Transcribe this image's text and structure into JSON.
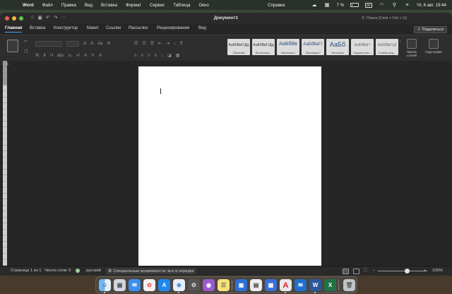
{
  "menubar": {
    "app_name": "Word",
    "items": [
      "Файл",
      "Правка",
      "Вид",
      "Вставка",
      "Формат",
      "Сервис",
      "Таблица",
      "Окно"
    ],
    "help": "Справка",
    "battery": "7 %",
    "clock": "Чт, 6 авг. 19:44",
    "keyboard_indicator": "PF"
  },
  "window": {
    "title": "Документ1",
    "search_placeholder": "Поиск (Cmd + Ctrl + U)",
    "share_label": "Поделиться"
  },
  "tabs": [
    {
      "label": "Главная",
      "active": true
    },
    {
      "label": "Вставка"
    },
    {
      "label": "Конструктор"
    },
    {
      "label": "Макет"
    },
    {
      "label": "Ссылки"
    },
    {
      "label": "Рассылки"
    },
    {
      "label": "Рецензирование"
    },
    {
      "label": "Вид"
    }
  ],
  "ribbon": {
    "paste_label": "Вставить",
    "styles": [
      {
        "preview": "АаБбВвГгДд",
        "name": "Обычный"
      },
      {
        "preview": "АаБбВвГгДд",
        "name": "Без интерв..."
      },
      {
        "preview": "АаБбВв",
        "name": "Заголовок 1"
      },
      {
        "preview": "АаБбВвГг",
        "name": "Заголовок 2"
      },
      {
        "preview": "АаБб",
        "name": "Заголовок"
      },
      {
        "preview": "АаБбВвГг",
        "name": "Подзаголово..."
      },
      {
        "preview": "АаБбВвГгД",
        "name": "Слабое выд..."
      }
    ],
    "styles_pane_label": "Панель стилей",
    "addins_label": "Надстройки"
  },
  "statusbar": {
    "page": "Страница 1 из 1",
    "words": "Число слов: 0",
    "language": "русский",
    "accessibility": "Специальные возможности: все в порядке",
    "zoom": "100%"
  },
  "dock": {
    "apps": [
      "finder-icon",
      "launchpad-icon",
      "mail-icon",
      "photos-icon",
      "app-store-icon",
      "safari-icon",
      "podcasts-icon",
      "notes-icon",
      "preview-icon",
      "calendar-icon",
      "grid-icon",
      "outlook-icon",
      "acrobat-icon",
      "word-icon",
      "excel-icon",
      "onedrive-icon",
      "trash-icon"
    ]
  },
  "colors": {
    "accent_tab": "#4aa3ff",
    "word_blue": "#2b579a",
    "excel_green": "#217346"
  }
}
